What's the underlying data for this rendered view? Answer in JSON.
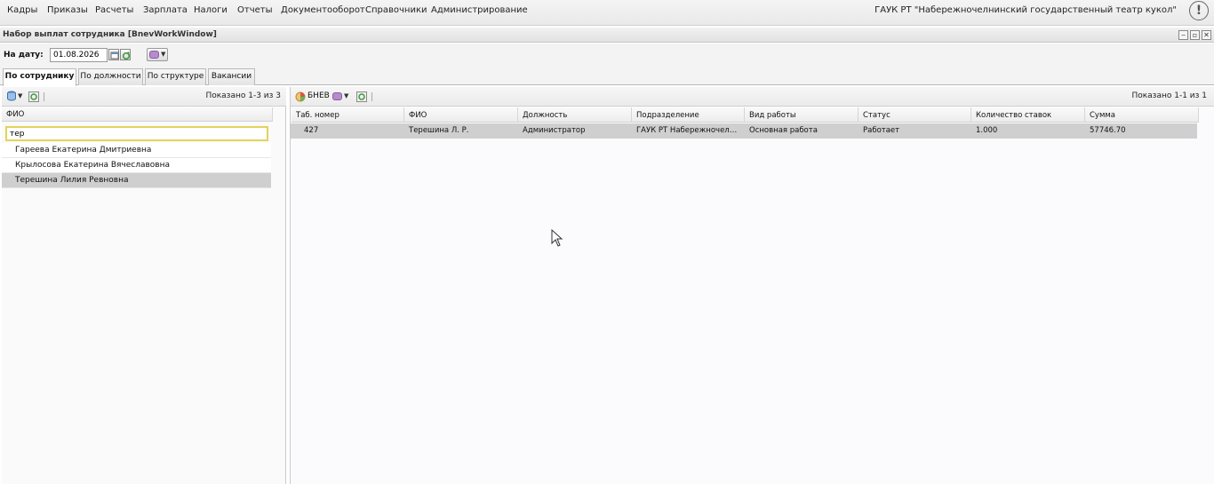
{
  "menu": {
    "items": [
      "Кадры",
      "Приказы",
      "Расчеты",
      "Зарплата",
      "Налоги",
      "Отчеты",
      "Документооборот",
      "Справочники",
      "Администрирование"
    ],
    "organization": "ГАУК РТ \"Набережночелнинский государственный театр кукол\"",
    "alert_icon": "!"
  },
  "window": {
    "title": "Набор выплат сотрудника [BnevWorkWindow]",
    "buttons": [
      "‒",
      "▫",
      "✕"
    ]
  },
  "date_filter": {
    "label": "На дату:",
    "value": "01.08.2026"
  },
  "tabs": [
    {
      "label": "По сотруднику",
      "active": true
    },
    {
      "label": "По должности",
      "active": false
    },
    {
      "label": "По структуре",
      "active": false
    },
    {
      "label": "Вакансии",
      "active": false
    }
  ],
  "left": {
    "shown": "Показано 1-3 из 3",
    "column": "ФИО",
    "filter_value": "тер",
    "rows": [
      {
        "name": "Гареева Екатерина Дмитриевна",
        "selected": false
      },
      {
        "name": "Крылосова Екатерина Вячеславовна",
        "selected": false
      },
      {
        "name": "Терешина Лилия Ревновна",
        "selected": true
      }
    ]
  },
  "right": {
    "toolbar_label": "БНЕВ",
    "shown": "Показано 1-1 из 1",
    "columns": [
      "Таб. номер",
      "ФИО",
      "Должность",
      "Подразделение",
      "Вид работы",
      "Статус",
      "Количество ставок",
      "Сумма"
    ],
    "rows": [
      [
        "427",
        "Терешина Л. Р.",
        "Администратор",
        "ГАУК РТ Набережночелнин…",
        "Основная работа",
        "Работает",
        "1.000",
        "57746.70"
      ]
    ]
  }
}
